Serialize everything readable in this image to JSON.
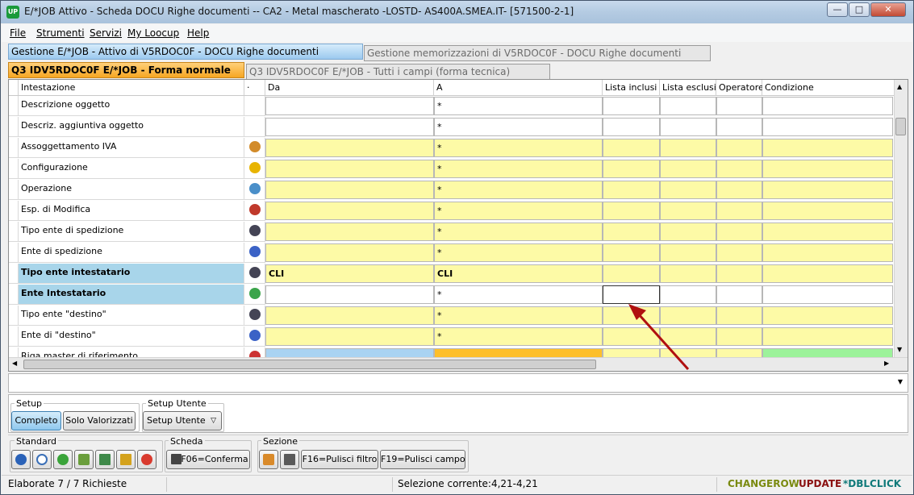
{
  "window": {
    "title": "E/*JOB Attivo - Scheda DOCU Righe documenti -- CA2 - Metal mascherato -LOSTD- AS400A.SMEA.IT- [571500-2-1]",
    "app_badge": "UP"
  },
  "menu": [
    "File",
    "Strumenti",
    "Servizi",
    "My Loocup",
    "Help"
  ],
  "tabs_top": {
    "active": "Gestione E/*JOB - Attivo di V5RDOC0F - DOCU Righe documenti",
    "inactive": "Gestione memorizzazioni di V5RDOC0F - DOCU Righe documenti"
  },
  "tabs_sub": {
    "active": "Q3 IDV5RDOC0F E/*JOB - Forma normale",
    "inactive": "Q3 IDV5RDOC0F E/*JOB - Tutti i campi (forma tecnica)"
  },
  "grid": {
    "headers": {
      "intestazione": "Intestazione",
      "dot": "·",
      "da": "Da",
      "a": "A",
      "lista_inclusi": "Lista inclusi",
      "lista_esclusi": "Lista esclusi",
      "operatore": "Operatore",
      "condizione": "Condizione"
    },
    "rows": [
      {
        "label": "Descrizione oggetto",
        "icon": "none",
        "da": "",
        "a": "*",
        "style": "white"
      },
      {
        "label": "Descriz. aggiuntiva oggetto",
        "icon": "none",
        "da": "",
        "a": "*",
        "style": "white"
      },
      {
        "label": "Assoggettamento IVA",
        "icon": "tax-icon",
        "da": "",
        "a": "*",
        "style": "yellow"
      },
      {
        "label": "Configurazione",
        "icon": "question-icon",
        "da": "",
        "a": "*",
        "style": "yellow"
      },
      {
        "label": "Operazione",
        "icon": "operation-icon",
        "da": "",
        "a": "*",
        "style": "yellow"
      },
      {
        "label": "Esp. di Modifica",
        "icon": "palette-icon",
        "da": "",
        "a": "*",
        "style": "yellow"
      },
      {
        "label": "Tipo ente di spedizione",
        "icon": "entity-type-icon",
        "da": "",
        "a": "*",
        "style": "yellow"
      },
      {
        "label": "Ente di spedizione",
        "icon": "person-icon",
        "da": "",
        "a": "*",
        "style": "yellow"
      },
      {
        "label": "Tipo ente intestatario",
        "icon": "entity-type-icon",
        "da": "CLI",
        "a": "CLI",
        "style": "highlight-yellow"
      },
      {
        "label": "Ente Intestatario",
        "icon": "person-green-icon",
        "da": "",
        "a": "*",
        "style": "highlight-white"
      },
      {
        "label": "Tipo ente \"destino\"",
        "icon": "entity-type-icon",
        "da": "",
        "a": "*",
        "style": "yellow"
      },
      {
        "label": "Ente di \"destino\"",
        "icon": "person-icon",
        "da": "",
        "a": "*",
        "style": "yellow"
      },
      {
        "label": "Riga master di riferimento",
        "icon": "numbers-icon",
        "da": "",
        "a": "",
        "style": "partial"
      }
    ]
  },
  "setup": {
    "title": "Setup",
    "buttons": [
      "Completo",
      "Solo Valorizzati"
    ],
    "user_title": "Setup Utente",
    "user_select": "Setup Utente"
  },
  "toolbar": {
    "standard_title": "Standard",
    "scheda_title": "Scheda",
    "scheda_button": "F06=Conferma",
    "sezione_title": "Sezione",
    "f16": "F16=Pulisci filtro",
    "f19": "F19=Pulisci campo"
  },
  "status": {
    "left": "Elaborate 7 / 7 Richieste",
    "selection": "Selezione corrente:4,21-4,21",
    "changerow": "CHANGEROW",
    "update": "UPDATE",
    "dblclick": "*DBLCLICK"
  },
  "colors": {
    "yellow_cell": "#fdfaa6",
    "highlight_label": "#a8d5ea",
    "arrow": "#b01010"
  }
}
